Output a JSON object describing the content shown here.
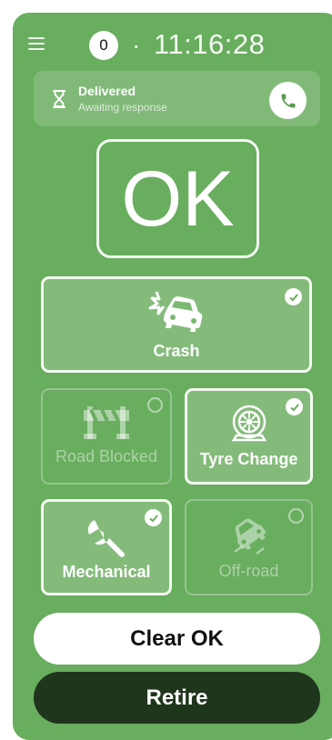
{
  "header": {
    "menu_icon": "menu-icon",
    "count": "0",
    "separator": "·",
    "time": "11:16:28"
  },
  "status": {
    "title": "Delivered",
    "subtitle": "Awaiting response",
    "status_icon": "hourglass-icon",
    "action_icon": "phone-icon"
  },
  "ok_label": "OK",
  "tiles": [
    {
      "label": "Crash",
      "icon": "car-crash-icon",
      "selected": true,
      "enabled": true
    },
    {
      "label": "Road Blocked",
      "icon": "road-barrier-icon",
      "selected": false,
      "enabled": false
    },
    {
      "label": "Tyre Change",
      "icon": "tyre-icon",
      "selected": true,
      "enabled": true
    },
    {
      "label": "Mechanical",
      "icon": "wrench-icon",
      "selected": true,
      "enabled": true
    },
    {
      "label": "Off-road",
      "icon": "car-off-road-icon",
      "selected": false,
      "enabled": false
    }
  ],
  "buttons": {
    "clear": "Clear OK",
    "retire": "Retire"
  },
  "colors": {
    "panel": "#69ad5f",
    "retire": "#1f351c",
    "text": "#ffffff"
  }
}
